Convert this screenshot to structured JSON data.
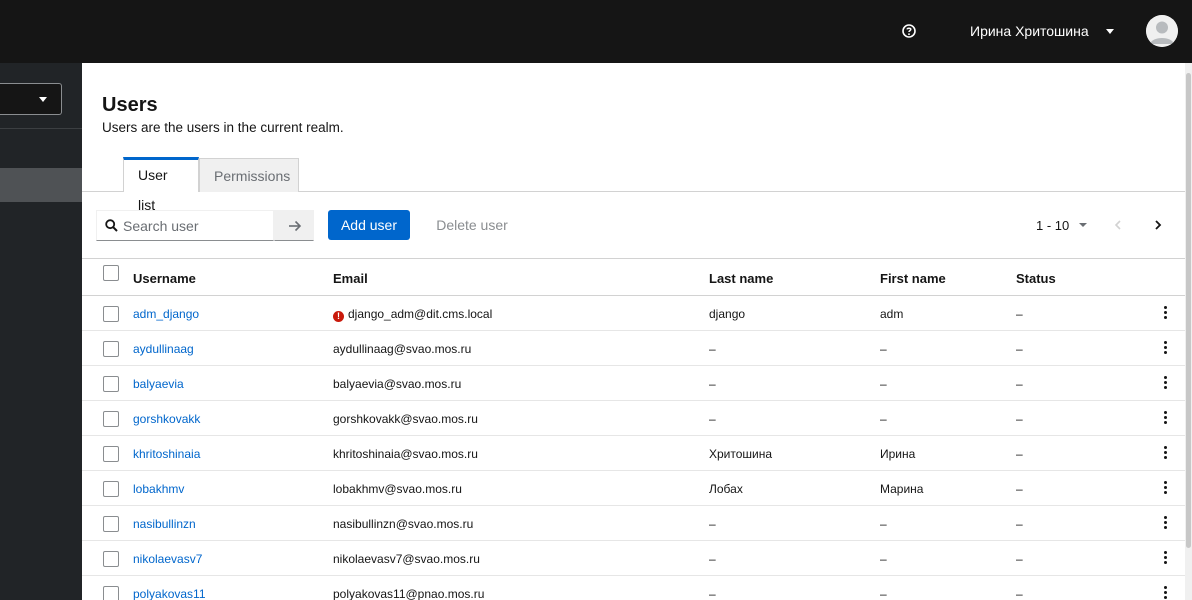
{
  "header": {
    "user_name": "Ирина Хритошина",
    "help_icon": "help-circle-icon",
    "avatar_icon": "user-avatar-icon"
  },
  "page": {
    "title": "Users",
    "description": "Users are the users in the current realm."
  },
  "tabs": [
    {
      "label": "User list",
      "active": true
    },
    {
      "label": "Permissions",
      "active": false
    }
  ],
  "toolbar": {
    "search_placeholder": "Search user",
    "add_label": "Add user",
    "delete_label": "Delete user",
    "pagination": "1 - 10"
  },
  "table": {
    "columns": [
      "Username",
      "Email",
      "Last name",
      "First name",
      "Status"
    ],
    "rows": [
      {
        "username": "adm_django",
        "email": "django_adm@dit.cms.local",
        "email_warning": true,
        "last_name": "django",
        "first_name": "adm",
        "status": "–"
      },
      {
        "username": "aydullinaag",
        "email": "aydullinaag@svao.mos.ru",
        "last_name": "–",
        "first_name": "–",
        "status": "–"
      },
      {
        "username": "balyaevia",
        "email": "balyaevia@svao.mos.ru",
        "last_name": "–",
        "first_name": "–",
        "status": "–"
      },
      {
        "username": "gorshkovakk",
        "email": "gorshkovakk@svao.mos.ru",
        "last_name": "–",
        "first_name": "–",
        "status": "–"
      },
      {
        "username": "khritoshinaia",
        "email": "khritoshinaia@svao.mos.ru",
        "last_name": "Хритошина",
        "first_name": "Ирина",
        "status": "–"
      },
      {
        "username": "lobakhmv",
        "email": "lobakhmv@svao.mos.ru",
        "last_name": "Лобах",
        "first_name": "Марина",
        "status": "–"
      },
      {
        "username": "nasibullinzn",
        "email": "nasibullinzn@svao.mos.ru",
        "last_name": "–",
        "first_name": "–",
        "status": "–"
      },
      {
        "username": "nikolaevasv7",
        "email": "nikolaevasv7@svao.mos.ru",
        "last_name": "–",
        "first_name": "–",
        "status": "–"
      },
      {
        "username": "polyakovas11",
        "email": "polyakovas11@pnao.mos.ru",
        "last_name": "–",
        "first_name": "–",
        "status": "–"
      }
    ]
  },
  "colors": {
    "masthead": "#151515",
    "sidebar": "#212427",
    "primary": "#0066cc",
    "danger": "#c9190b"
  }
}
